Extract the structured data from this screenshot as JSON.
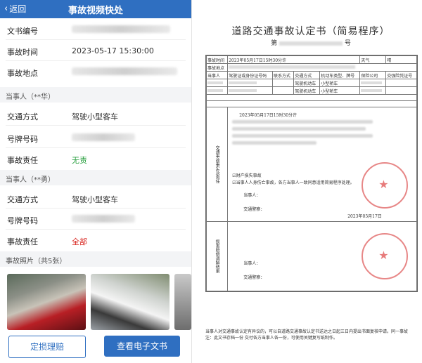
{
  "app": {
    "title": "事故视频快处",
    "back_label": "返回",
    "back_icon": "chevron-left-icon"
  },
  "info": {
    "doc_no_label": "文书编号",
    "time_label": "事故时间",
    "time_value": "2023-05-17 15:30:00",
    "place_label": "事故地点"
  },
  "party1": {
    "header": "当事人（**华）",
    "transport_label": "交通方式",
    "transport_value": "驾驶小型客车",
    "plate_label": "号牌号码",
    "liability_label": "事故责任",
    "liability_value": "无责"
  },
  "party2": {
    "header": "当事人（**勇）",
    "transport_label": "交通方式",
    "transport_value": "驾驶小型客车",
    "plate_label": "号牌号码",
    "liability_label": "事故责任",
    "liability_value": "全部"
  },
  "photos": {
    "header": "事故照片（共5张）"
  },
  "buttons": {
    "claim": "定损理赔",
    "view_doc": "查看电子文书"
  },
  "colors": {
    "brand": "#2f6fc1",
    "green": "#2aa040",
    "red": "#d8251f"
  },
  "document": {
    "title": "道路交通事故认定书（简易程序）",
    "number": "第",
    "number_suffix": "号",
    "row1": {
      "c1": "事故时间",
      "c2": "2023年05月17日15时30分许",
      "c3": "天气",
      "c4": "晴"
    },
    "row2": {
      "c1": "事故地点"
    },
    "headers": [
      "当事人",
      "驾驶证或身份证号码",
      "联系方式",
      "交通方式",
      "机动车类型、牌号",
      "保险公司",
      "交强险凭证号"
    ],
    "row3": {
      "mode": "驾驶机动车",
      "vehicle": "小型轿车"
    },
    "row4": {
      "mode": "驾驶机动车",
      "vehicle": "小型轿车"
    },
    "side1": "交通事故事实及责任",
    "side2": "损害赔偿调解结果",
    "fact_date": "2023年05月17日15时30分许",
    "fact_loss": "☑财产损失事故",
    "fact_line": "☑当事人人身伤亡事故，各方当事人一致同意适用简易程序处理。",
    "party": "当事人：",
    "police": "交通警察：",
    "sign_date": "2023年05月17日",
    "footer1": "当事人对交通事故认定有异议的，可以自道路交通事故认定书送达之日起三日内提出书面复核申请。同一事故",
    "footer2": "注：此文书存档一份  交付各方当事人各一份，可使用关键复写纸制作。"
  }
}
